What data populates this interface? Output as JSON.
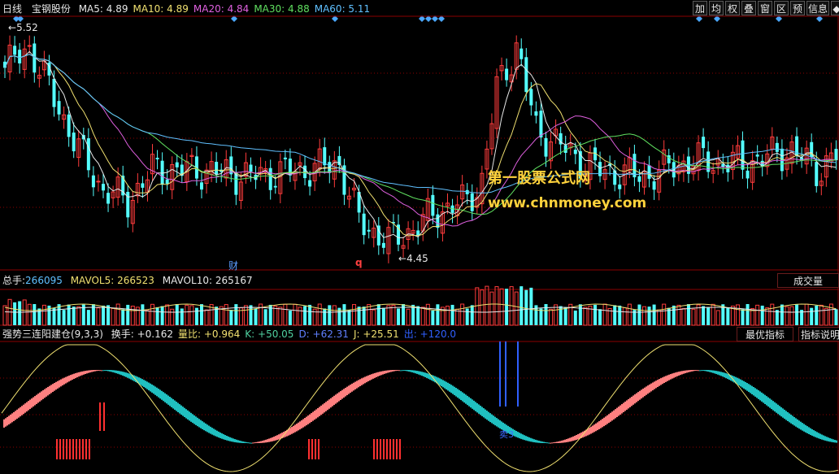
{
  "top_bar": {
    "period": "日线",
    "stock_name": "宝钢股份",
    "ma": [
      {
        "label": "MA5:",
        "value": "4.89",
        "color": "#e8e8e8"
      },
      {
        "label": "MA10:",
        "value": "4.89",
        "color": "#f0e070"
      },
      {
        "label": "MA20:",
        "value": "4.84",
        "color": "#e060e0"
      },
      {
        "label": "MA30:",
        "value": "4.88",
        "color": "#60e060"
      },
      {
        "label": "MA60:",
        "value": "5.11",
        "color": "#60c0ff"
      }
    ],
    "toolbar": [
      "加",
      "均",
      "权",
      "叠",
      "窗",
      "区",
      "预",
      "信息",
      "◆"
    ]
  },
  "main_chart": {
    "high_label": "5.52",
    "low_label": "4.45",
    "marker_cai": "财",
    "marker_q": "q",
    "watermark_cn": "第一股票公式网",
    "watermark_url": "www.chnmoney.com"
  },
  "volume_panel": {
    "total_label": "总手:",
    "total_value": "266095",
    "mavol5_label": "MAVOL5:",
    "mavol5_value": "266523",
    "mavol10_label": "MAVOL10:",
    "mavol10_value": "265167",
    "button": "成交量"
  },
  "indicator_panel": {
    "name": "强势三连阳建仓(9,3,3)",
    "items": [
      {
        "label": "换手:",
        "value": "+0.162",
        "color": "#e8e8e8"
      },
      {
        "label": "量比:",
        "value": "+0.964",
        "color": "#f0e070"
      },
      {
        "label": "K:",
        "value": "+50.05",
        "color": "#50d0a0"
      },
      {
        "label": "D:",
        "value": "+62.31",
        "color": "#6080ff"
      },
      {
        "label": "J:",
        "value": "+25.51",
        "color": "#f0e070"
      },
      {
        "label": "出:",
        "value": "+120.0",
        "color": "#3060ff"
      }
    ],
    "button1": "最优指标",
    "button2": "指标说明",
    "sell_label": "卖3"
  },
  "colors": {
    "up": "#ff3c3c",
    "down": "#54ffff",
    "grid": "#8b0000"
  }
}
